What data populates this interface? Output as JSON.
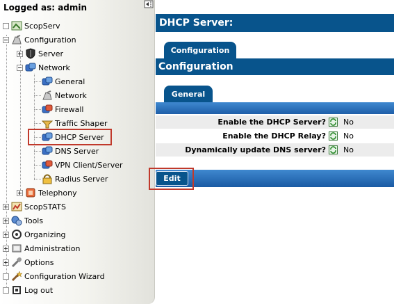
{
  "header": {
    "logged_as": "Logged as: admin"
  },
  "tree": {
    "scopserv": "ScopServ",
    "configuration": "Configuration",
    "server": "Server",
    "network": "Network",
    "general": "General",
    "network_sub": "Network",
    "firewall": "Firewall",
    "traffic_shaper": "Traffic Shaper",
    "dhcp_server": "DHCP Server",
    "dns_server": "DNS Server",
    "vpn": "VPN Client/Server",
    "radius": "Radius Server",
    "telephony": "Telephony",
    "scopstats": "ScopSTATS",
    "tools": "Tools",
    "organizing": "Organizing",
    "administration": "Administration",
    "options": "Options",
    "wizard": "Configuration Wizard",
    "logout": "Log out"
  },
  "main": {
    "page_title": "DHCP Server:",
    "tab_configuration": "Configuration",
    "section_title": "Configuration",
    "tab_general": "General",
    "rows": [
      {
        "question": "Enable the DHCP Server?",
        "value": "No"
      },
      {
        "question": "Enable the DHCP Relay?",
        "value": "No"
      },
      {
        "question": "Dynamically update DNS server?",
        "value": "No"
      }
    ],
    "edit_label": "Edit"
  },
  "colors": {
    "primary_blue": "#08548c",
    "highlight_red": "#c0392b"
  }
}
